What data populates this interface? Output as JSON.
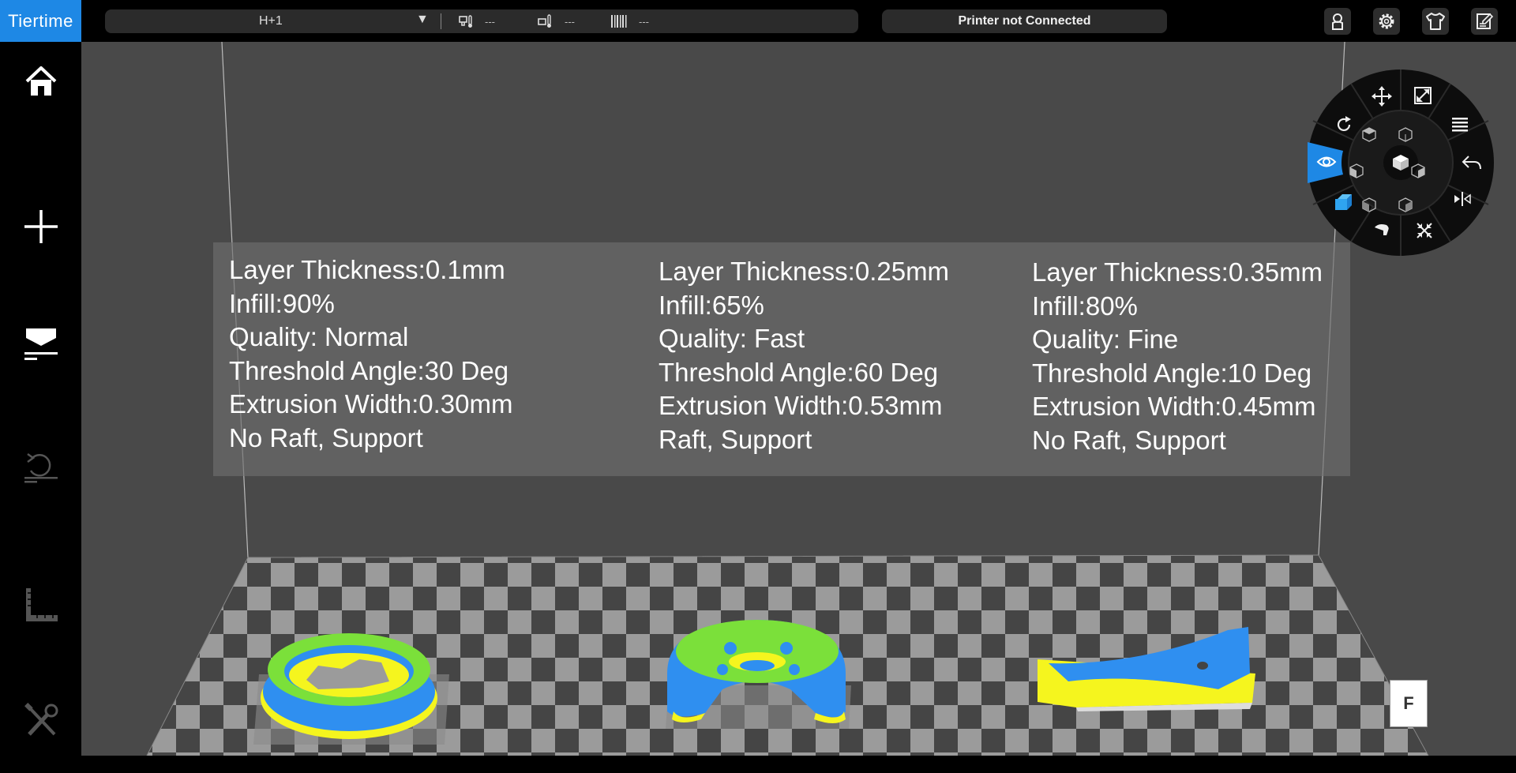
{
  "app": {
    "logo_text": "Tiertime",
    "brand_color": "#1e88e5"
  },
  "status": {
    "printer_name": "H+1",
    "dropdown_arrow": "▼",
    "nozzle_temp": "---",
    "bed_temp": "---",
    "material": "---",
    "connection": "Printer not Connected"
  },
  "top_buttons": [
    "user-icon",
    "settings-gear-icon",
    "shirt-icon",
    "edit-note-icon"
  ],
  "sidebar": [
    "home-icon",
    "add-icon",
    "print-icon",
    "undo-icon",
    "ruler-icon",
    "tools-icon"
  ],
  "info": {
    "col1": [
      "Layer Thickness:0.1mm",
      "Infill:90%",
      "Quality: Normal",
      "Threshold Angle:30 Deg",
      "Extrusion Width:0.30mm",
      "No Raft, Support"
    ],
    "col2": [
      "Layer Thickness:0.25mm",
      "Infill:65%",
      "Quality: Fast",
      "Threshold Angle:60 Deg",
      "Extrusion Width:0.53mm",
      "Raft, Support"
    ],
    "col3": [
      "Layer Thickness:0.35mm",
      "Infill:80%",
      "Quality: Fine",
      "Threshold Angle:10 Deg",
      "Extrusion Width:0.45mm",
      "No Raft, Support"
    ]
  },
  "radial_menu": {
    "active": "view-eye-icon",
    "active_color": "#1e88e5",
    "items": [
      "move-icon",
      "scale-icon",
      "slice-layers-icon",
      "undo-icon",
      "mirror-icon",
      "shrink-icon",
      "hand-icon",
      "cube-icon",
      "view-eye-icon",
      "rotate-icon"
    ]
  },
  "view_label": "F",
  "model_colors": {
    "shell": "#2f8ff0",
    "top": "#7be03a",
    "support": "#f5f51e"
  }
}
